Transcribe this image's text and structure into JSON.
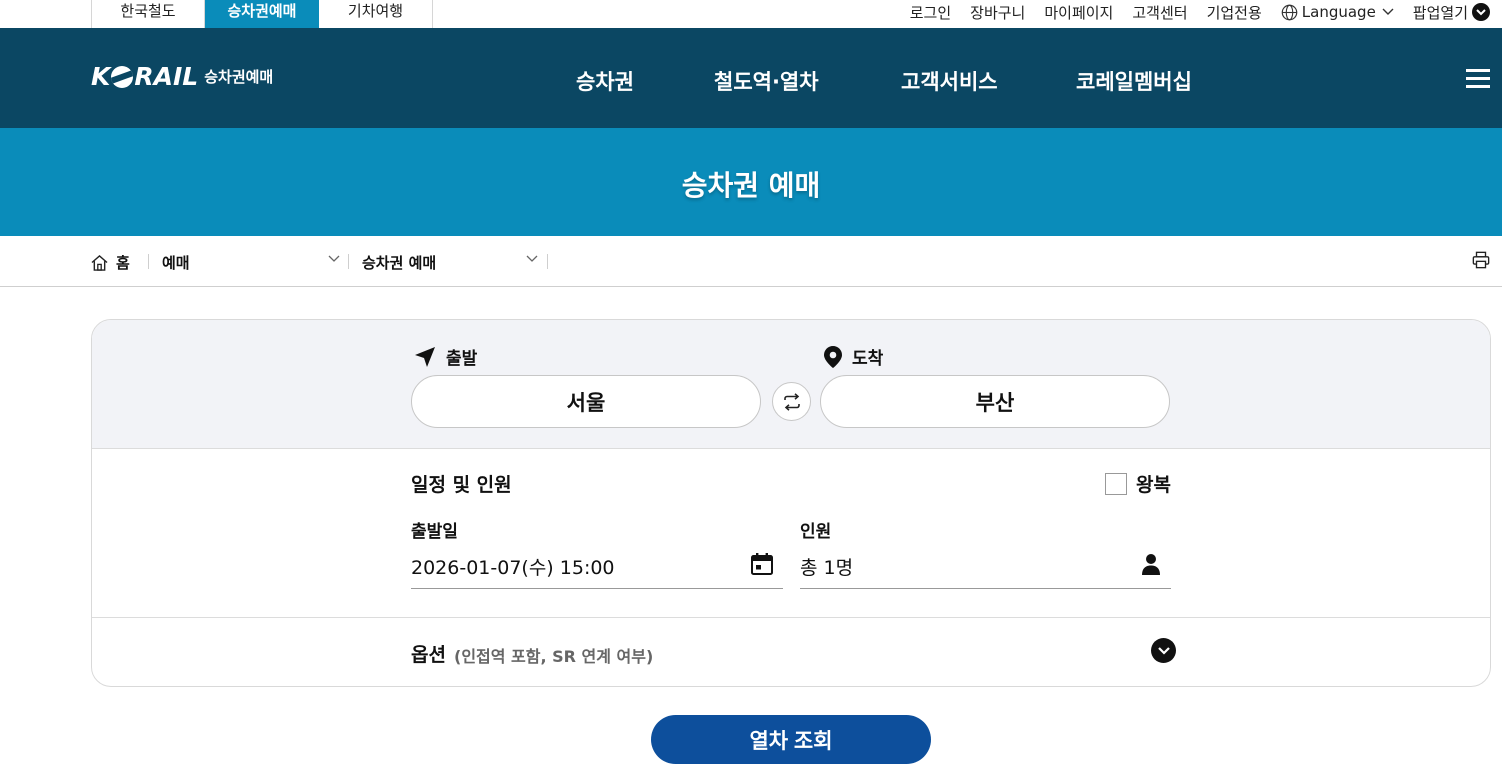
{
  "site_tabs": [
    "한국철도",
    "승차권예매",
    "기차여행"
  ],
  "utility": {
    "login": "로그인",
    "cart": "장바구니",
    "mypage": "마이페이지",
    "support": "고객센터",
    "corporate": "기업전용",
    "language": "Language",
    "popup": "팝업열기"
  },
  "logo": {
    "word_pre": "K",
    "word_post": "RAIL",
    "sub": "승차권예매"
  },
  "gnb": [
    "승차권",
    "철도역·열차",
    "고객서비스",
    "코레일멤버십"
  ],
  "page_title": "승차권 예매",
  "breadcrumb": {
    "home": "홈",
    "level1": "예매",
    "level2": "승차권 예매"
  },
  "route": {
    "departure_label": "출발",
    "arrival_label": "도착",
    "departure": "서울",
    "arrival": "부산"
  },
  "schedule": {
    "title": "일정 및 인원",
    "round_trip_label": "왕복",
    "round_trip_checked": false,
    "date_label": "출발일",
    "date_value": "2026-01-07(수) 15:00",
    "passenger_label": "인원",
    "passenger_value": "총 1명"
  },
  "options": {
    "title": "옵션",
    "subtitle": "(인접역 포함, SR 연계 여부)"
  },
  "search_button": "열차 조회",
  "colors": {
    "header": "#0b4763",
    "accent": "#0a8cba",
    "button": "#0d4f9c"
  }
}
